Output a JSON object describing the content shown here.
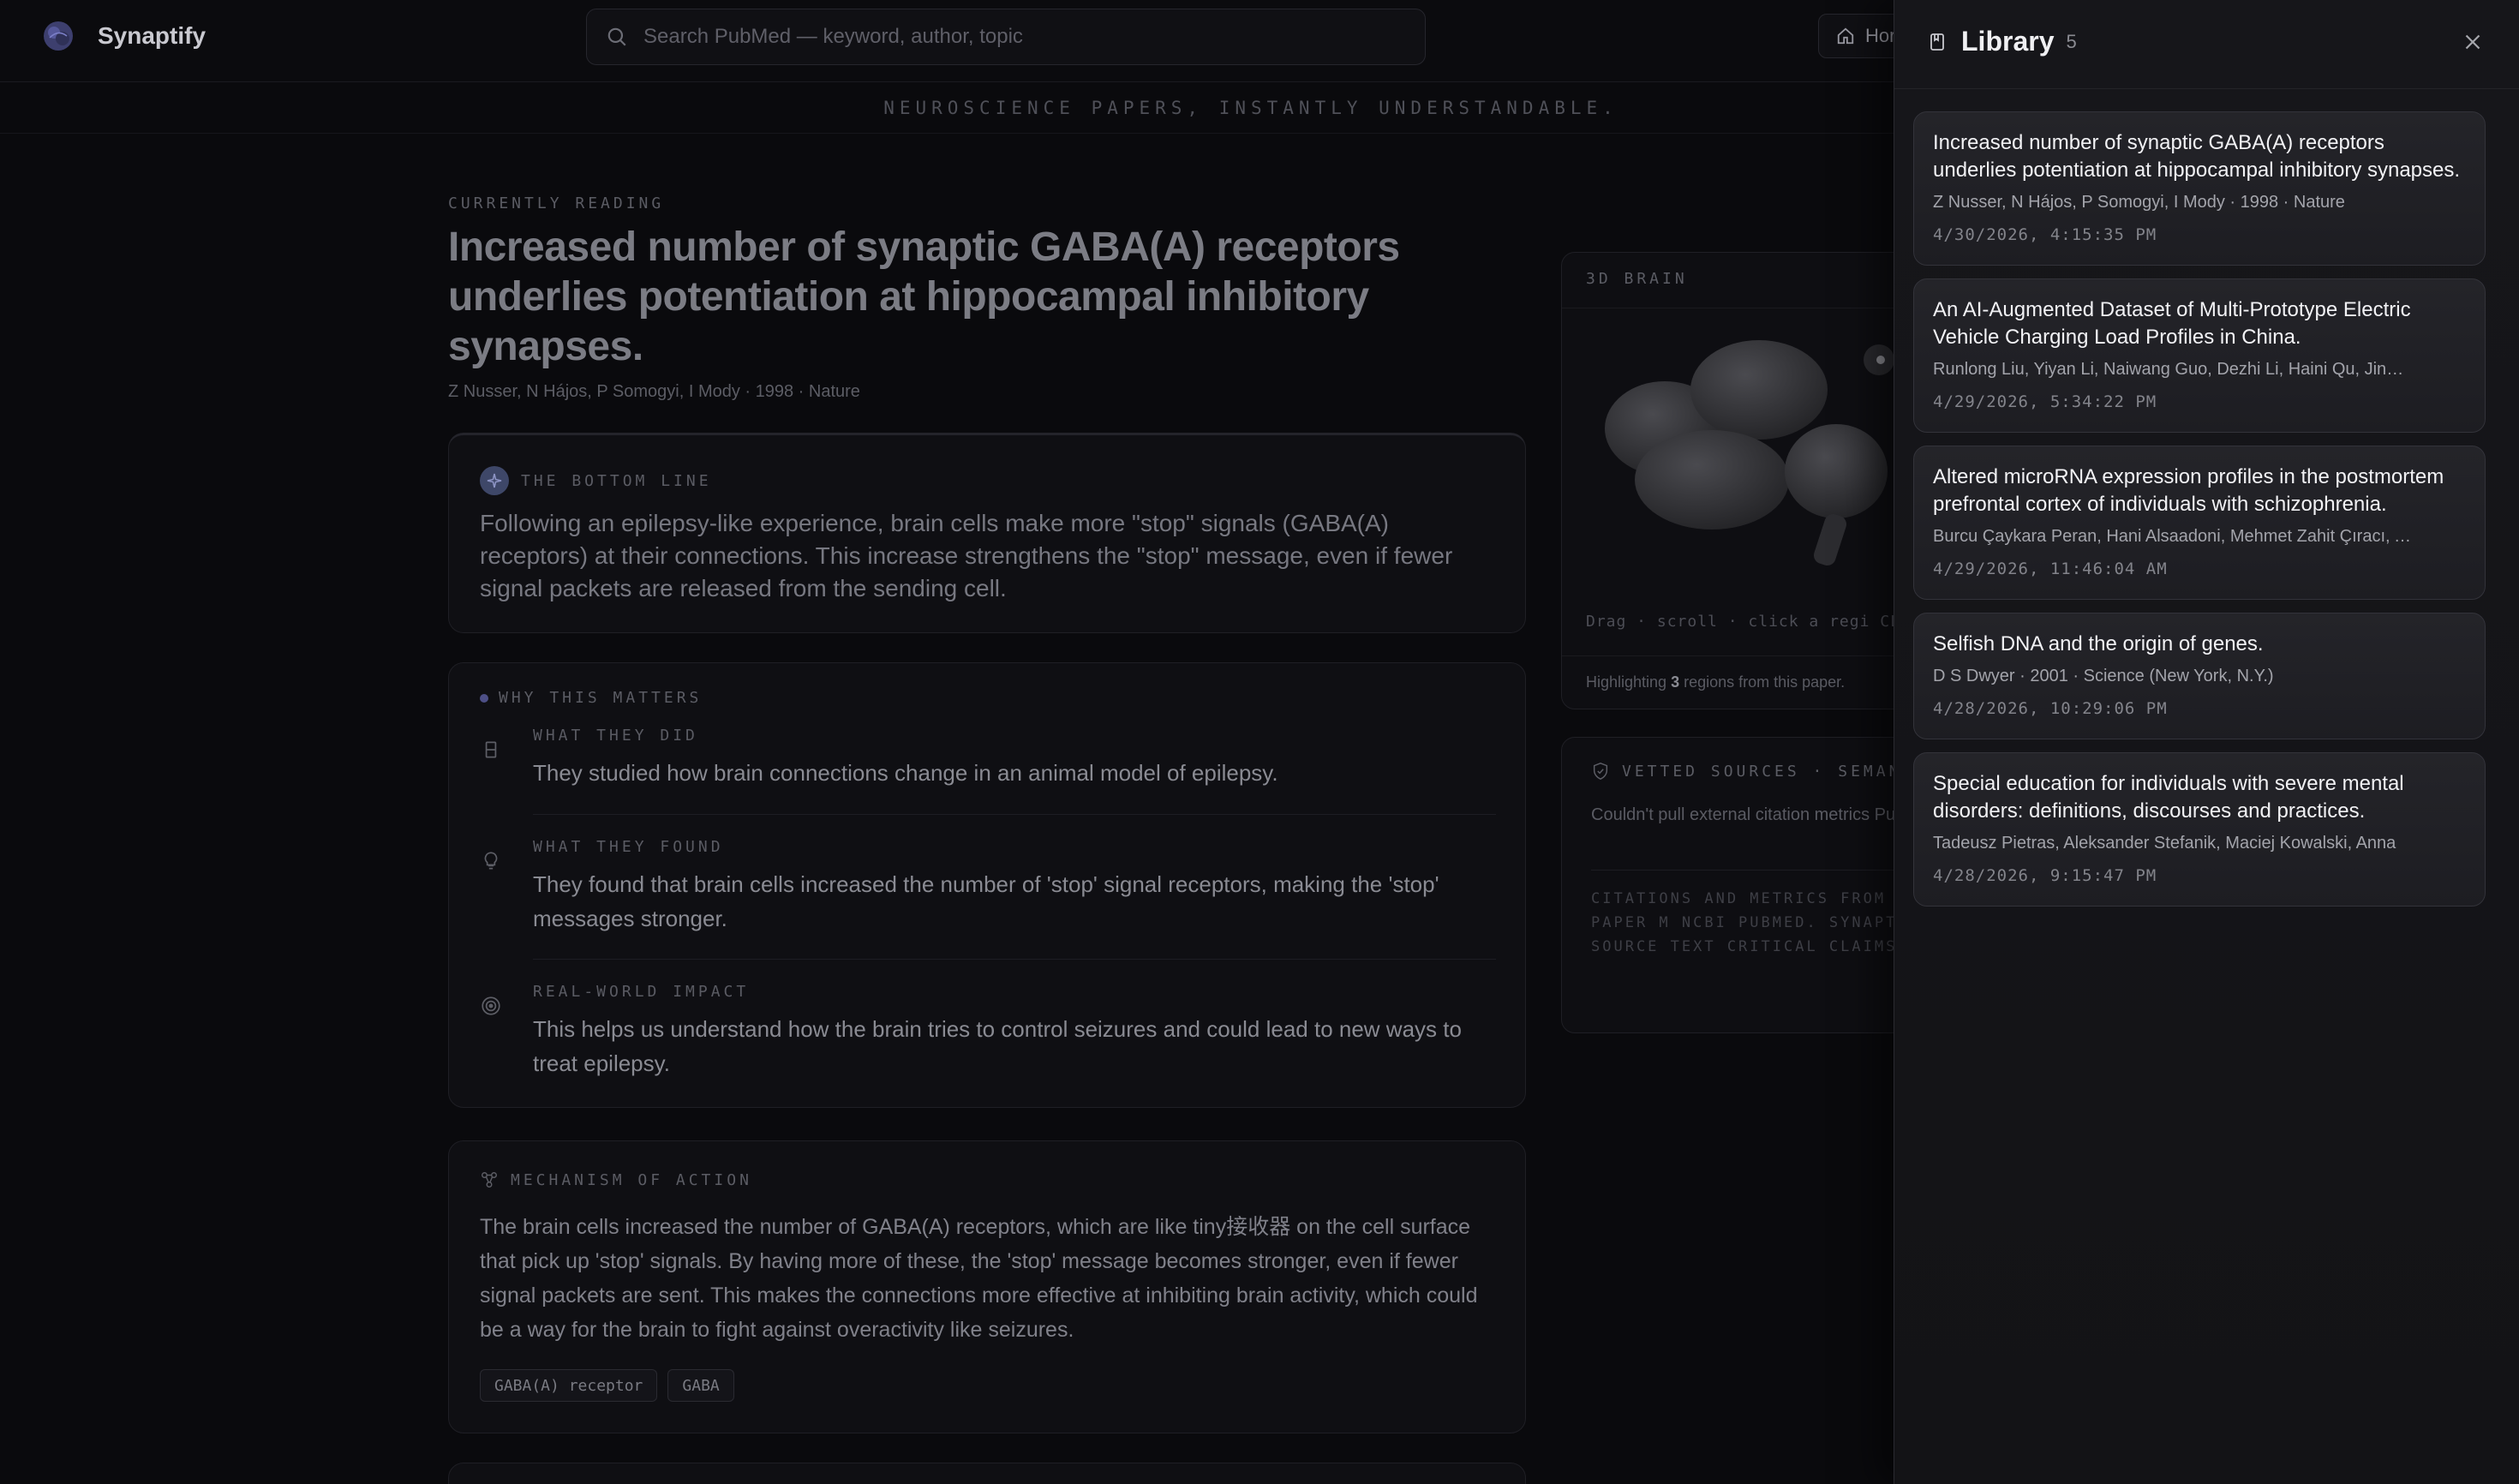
{
  "header": {
    "brand": "Synaptify",
    "search_placeholder": "Search PubMed — keyword, author, topic",
    "home_label": "Hor",
    "tagline": "NEUROSCIENCE PAPERS, INSTANTLY UNDERSTANDABLE."
  },
  "paper": {
    "eyebrow": "CURRENTLY READING",
    "title": "Increased number of synaptic GABA(A) receptors underlies potentiation at hippocampal inhibitory synapses.",
    "meta": "Z Nusser, N Hájos, P Somogyi, I Mody · 1998 · Nature"
  },
  "bottom_line": {
    "label": "THE BOTTOM LINE",
    "text": "Following an epilepsy-like experience, brain cells make more \"stop\" signals (GABA(A) receptors) at their connections. This increase strengthens the \"stop\" message, even if fewer signal packets are released from the sending cell."
  },
  "why": {
    "label": "WHY THIS MATTERS",
    "items": [
      {
        "label": "WHAT THEY DID",
        "text": "They studied how brain connections change in an animal model of epilepsy."
      },
      {
        "label": "WHAT THEY FOUND",
        "text": "They found that brain cells increased the number of 'stop' signal receptors, making the 'stop' messages stronger."
      },
      {
        "label": "REAL-WORLD IMPACT",
        "text": "This helps us understand how the brain tries to control seizures and could lead to new ways to treat epilepsy."
      }
    ]
  },
  "mechanism": {
    "label": "MECHANISM OF ACTION",
    "text": "The brain cells increased the number of GABA(A) receptors, which are like tiny接收器 on the cell surface that pick up 'stop' signals. By having more of these, the 'stop' message becomes stronger, even if fewer signal packets are sent. This makes the connections more effective at inhibiting brain activity, which could be a way for the brain to fight against overactivity like seizures.",
    "tags": [
      "GABA(A) receptor",
      "GABA"
    ]
  },
  "brain": {
    "label": "3D BRAIN",
    "hint": "Drag · scroll · click a regi",
    "hint_cut": "CLI",
    "foot_pre": "Highlighting ",
    "foot_count": "3",
    "foot_post": " regions from this paper."
  },
  "sources": {
    "label": "VETTED SOURCES · SEMANT",
    "text": "Couldn't pull external citation metrics PubMed record below is still authorita",
    "fine": "CITATIONS AND METRICS FROM SEM SCHOLAR'S OPEN CORPUS. PAPER M NCBI PUBMED. SYNAPTIFY SUMMARI GENERATED FROM THE SOURCE TEXT CRITICAL CLAIMS AGAINST THE OR"
  },
  "library": {
    "title": "Library",
    "count": "5",
    "items": [
      {
        "title": "Increased number of synaptic GABA(A) receptors underlies potentiation at hippocampal inhibitory synapses.",
        "authors": "Z Nusser, N Hájos, P Somogyi, I Mody · 1998 · Nature",
        "time": "4/30/2026, 4:15:35 PM"
      },
      {
        "title": "An AI-Augmented Dataset of Multi-Prototype Electric Vehicle Charging Load Profiles in China.",
        "authors": "Runlong Liu, Yiyan Li, Naiwang Guo, Dezhi Li, Haini Qu, Jinhan Zhang",
        "time": "4/29/2026, 5:34:22 PM"
      },
      {
        "title": "Altered microRNA expression profiles in the postmortem prefrontal cortex of individuals with schizophrenia.",
        "authors": "Burcu Çaykara Peran, Hani Alsaadoni, Mehmet Zahit Çıracı, Ayşe",
        "time": "4/29/2026, 11:46:04 AM"
      },
      {
        "title": "Selfish DNA and the origin of genes.",
        "authors": "D S Dwyer · 2001 · Science (New York, N.Y.)",
        "time": "4/28/2026, 10:29:06 PM"
      },
      {
        "title": "Special education for individuals with severe mental disorders: definitions, discourses and practices.",
        "authors": "Tadeusz Pietras, Aleksander Stefanik, Maciej Kowalski, Anna",
        "time": "4/28/2026, 9:15:47 PM"
      }
    ]
  }
}
